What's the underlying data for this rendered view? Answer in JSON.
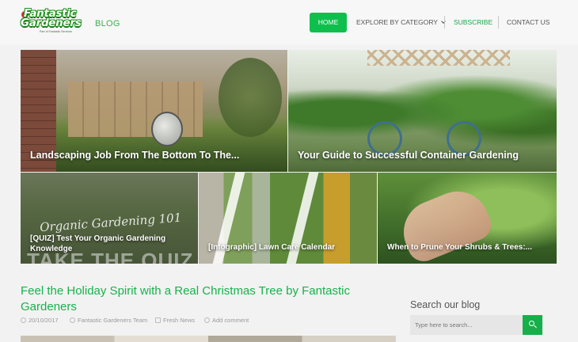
{
  "header": {
    "logo_line1": "Fantastic",
    "logo_line2": "Gardeners",
    "logo_tagline": "Part of Fantastic Services",
    "blog_label": "BLOG"
  },
  "nav": {
    "home": "HOME",
    "category": "EXPLORE BY CATEGORY",
    "subscribe": "SUBSCRIBE",
    "contact": "CONTACT US"
  },
  "featured": [
    {
      "title": "Landscaping Job From The Bottom To The..."
    },
    {
      "title": "Your Guide to Successful Container Gardening"
    },
    {
      "title": "[QUIZ] Test Your Organic Gardening Knowledge",
      "image_text": "Organic Gardening 101",
      "image_text2": "TAKE THE QUIZ"
    },
    {
      "title": "[Infographic] Lawn Care Calendar"
    },
    {
      "title": "When to Prune Your Shrubs & Trees:..."
    }
  ],
  "post": {
    "title": "Feel the Holiday Spirit with a Real Christmas Tree by Fantastic Gardeners",
    "date": "20/10/2017",
    "author": "Fantastic Gardeners Team",
    "category": "Fresh News",
    "comment": "Add comment"
  },
  "sidebar": {
    "search_title": "Search our blog",
    "search_placeholder": "Type here to search..."
  },
  "colors": {
    "brand_green": "#0fbf4d",
    "title_green": "#17b24c"
  }
}
